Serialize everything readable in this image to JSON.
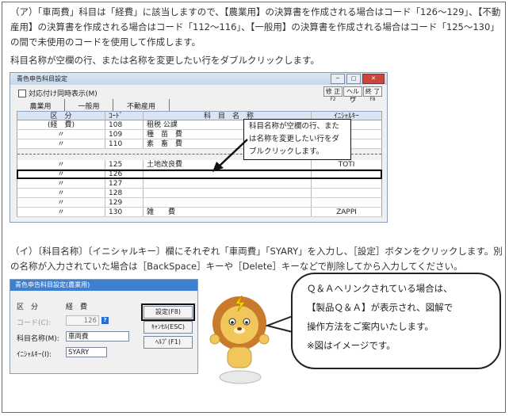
{
  "para1": "（ア）「車両費」科目は「経費」に該当しますので、【農業用】の決算書を作成される場合はコード「126〜129」、【不動産用】の決算書を作成される場合はコード「112〜116」、【一般用】の決算書を作成される場合はコード「125〜130」の間で未使用のコードを使用して作成します。",
  "para2": "科目名称が空欄の行、または名称を変更したい行をダブルクリックします。",
  "para3": "（イ）〔科目名称〕〔イニシャルキー〕欄にそれぞれ「車両費」「SYARY」を入力し、［設定］ボタンをクリックします。別の名称が入力されていた場合は［BackSpace］キーや［Delete］キーなどで削除してから入力してください。",
  "window1": {
    "title": "青色申告科目設定",
    "ctrl_min": "─",
    "ctrl_max": "□",
    "ctrl_close": "✕",
    "checkbox_label": "対応付け同時表示(M)",
    "fbtns": [
      {
        "label": "修 正",
        "key": "F2"
      },
      {
        "label": "ヘルプ",
        "key": "F1"
      },
      {
        "label": "終 了",
        "key": "F8"
      }
    ],
    "tabs": [
      "農業用",
      "一般用",
      "不動産用"
    ],
    "headers": [
      "区　分",
      "ｺｰﾄﾞ",
      "科　目　名　称",
      "ｲﾆｼｬﾙｷｰ"
    ],
    "rows_top": [
      [
        "(経　費)",
        "108",
        "租税 公課",
        ""
      ],
      [
        "〃",
        "109",
        "種　苗　費",
        ""
      ],
      [
        "〃",
        "110",
        "素　畜　費",
        ""
      ]
    ],
    "rows_bottom": [
      [
        "〃",
        "125",
        "土地改良費",
        "TOTI"
      ],
      [
        "〃",
        "126",
        "",
        ""
      ],
      [
        "〃",
        "127",
        "",
        ""
      ],
      [
        "〃",
        "128",
        "",
        ""
      ],
      [
        "〃",
        "129",
        "",
        ""
      ],
      [
        "〃",
        "130",
        "雑　　費",
        "ZAPPI"
      ]
    ],
    "callout": "科目名称が空欄の行、または名称を変更したい行をダブルクリックします。"
  },
  "window2": {
    "title": "青色申告科目設定(農業用)",
    "kubun_label": "区　分",
    "kubun_value": "経　費",
    "code_label": "コード(C):",
    "code_value": "126",
    "name_label": "科目名称(M):",
    "name_value": "車両費",
    "initial_label": "ｲﾆｼｬﾙｷｰ(I):",
    "initial_value": "SYARY",
    "buttons": [
      "設定(F8)",
      "ｷｬﾝｾﾙ(ESC)",
      "ﾍﾙﾌﾟ(F1)"
    ]
  },
  "bubble": {
    "line1": "Ｑ＆Ａへリンクされている場合は、",
    "line2": "【製品Ｑ＆Ａ】が表示され、図解で",
    "line3": "操作方法をご案内いたします。",
    "line4": "※図はイメージです。"
  }
}
